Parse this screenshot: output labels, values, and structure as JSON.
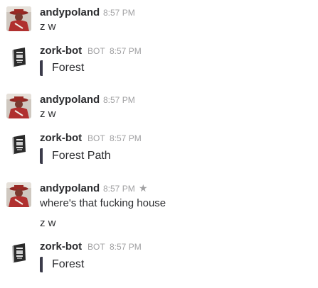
{
  "messages": [
    {
      "author": "andypoland",
      "time": "8:57 PM",
      "text": "z w"
    },
    {
      "author": "zork-bot",
      "badge": "BOT",
      "time": "8:57 PM",
      "attachment": "Forest"
    },
    {
      "author": "andypoland",
      "time": "8:57 PM",
      "text": "z w"
    },
    {
      "author": "zork-bot",
      "badge": "BOT",
      "time": "8:57 PM",
      "attachment": "Forest Path"
    },
    {
      "author": "andypoland",
      "time": "8:57 PM",
      "text": "where's that fucking house",
      "text2": "z w",
      "star_icon": "star-icon"
    },
    {
      "author": "zork-bot",
      "badge": "BOT",
      "time": "8:57 PM",
      "attachment": "Forest"
    }
  ],
  "colors": {
    "attachment_bar": "#3b3b4a",
    "meta": "#a0a0a2",
    "avatar_red": "#b0302f"
  }
}
